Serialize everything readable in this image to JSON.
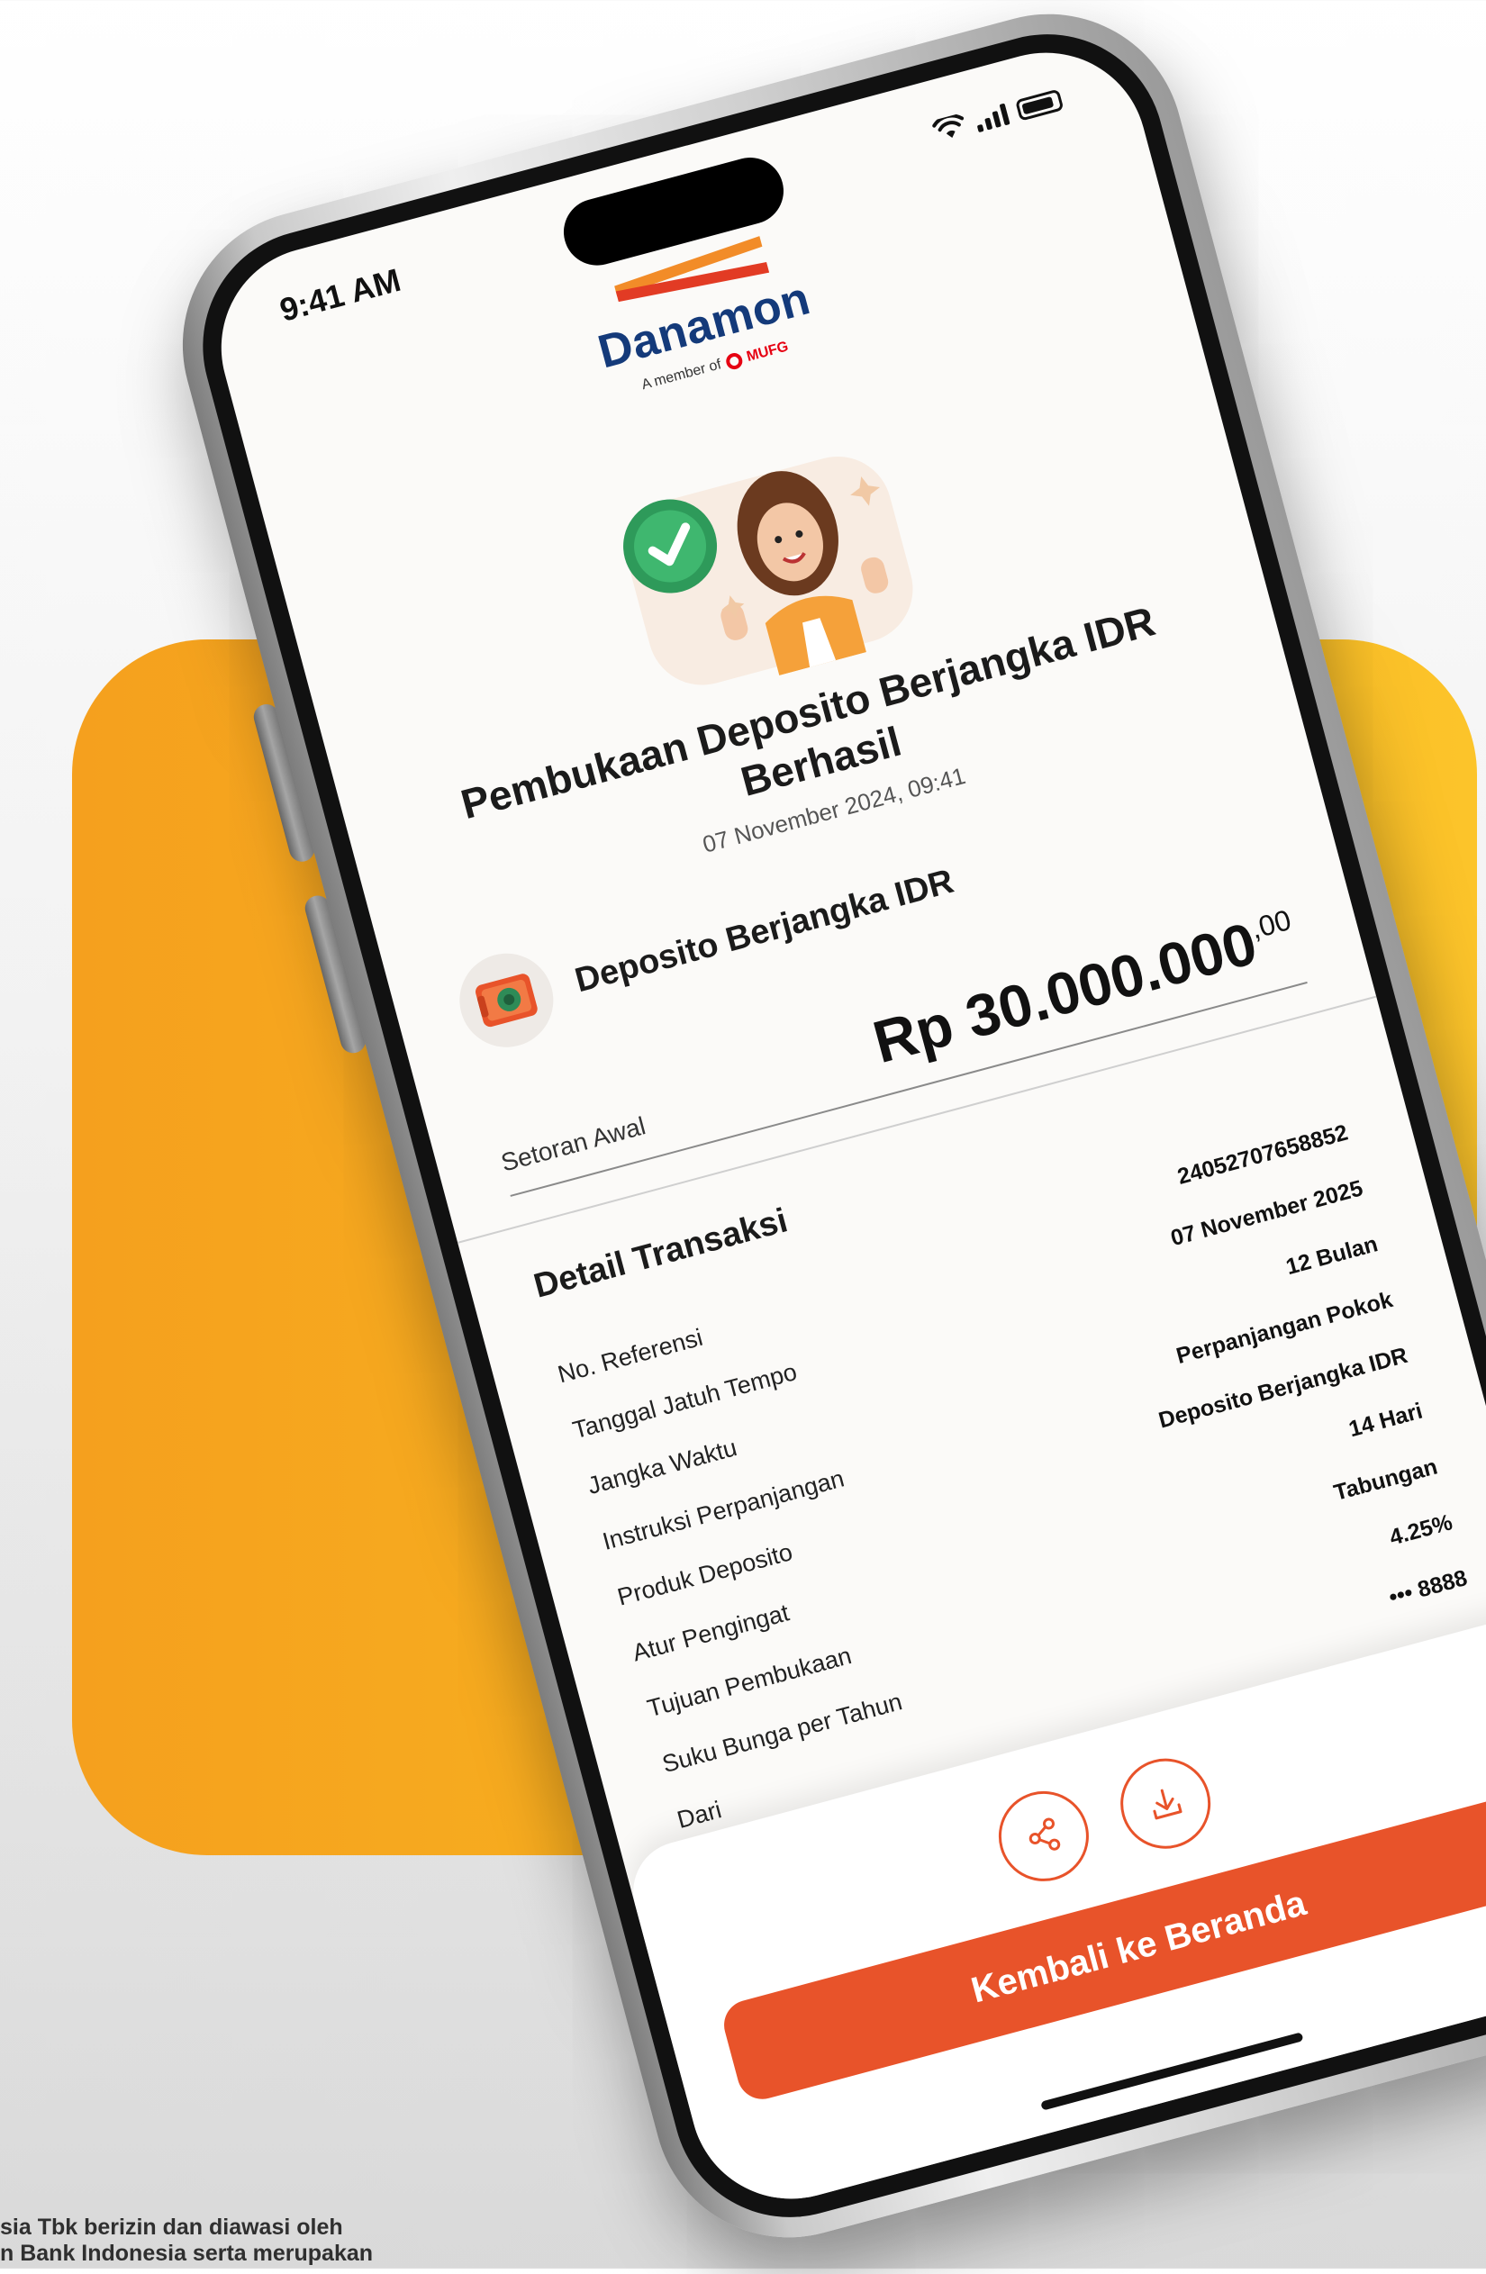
{
  "status_bar": {
    "time": "9:41 AM"
  },
  "brand": {
    "name": "Danamon",
    "member_of": "A member of",
    "partner": "MUFG"
  },
  "result": {
    "title_line1": "Pembukaan Deposito Berjangka IDR",
    "title_line2": "Berhasil",
    "datetime": "07 November 2024, 09:41"
  },
  "product": {
    "name": "Deposito Berjangka IDR",
    "icon": "deposit-safe-icon"
  },
  "amount": {
    "label": "Setoran Awal",
    "value": "Rp 30.000.000",
    "cents": ",00"
  },
  "detail": {
    "title": "Detail Transaksi",
    "rows": [
      {
        "label": "No. Referensi",
        "value": "24052707658852"
      },
      {
        "label": "Tanggal Jatuh Tempo",
        "value": "07 November 2025"
      },
      {
        "label": "Jangka Waktu",
        "value": "12 Bulan"
      },
      {
        "label": "Instruksi Perpanjangan",
        "value": "Perpanjangan Pokok"
      },
      {
        "label": "Produk Deposito",
        "value": "Deposito Berjangka IDR"
      },
      {
        "label": "Atur Pengingat",
        "value": "14 Hari"
      },
      {
        "label": "Tujuan Pembukaan",
        "value": "Tabungan"
      },
      {
        "label": "Suku Bunga per Tahun",
        "value": "4.25%"
      },
      {
        "label": "Dari",
        "value": "••• 8888"
      }
    ]
  },
  "actions": {
    "share_icon": "share-icon",
    "download_icon": "download-icon",
    "primary_label": "Kembali ke Beranda"
  },
  "footer": {
    "line1": "sia Tbk berizin dan diawasi oleh",
    "line2": "n Bank Indonesia serta merupakan"
  },
  "colors": {
    "accent": "#e8532a",
    "panel": "#f8b320",
    "brand_blue": "#143a7a"
  }
}
